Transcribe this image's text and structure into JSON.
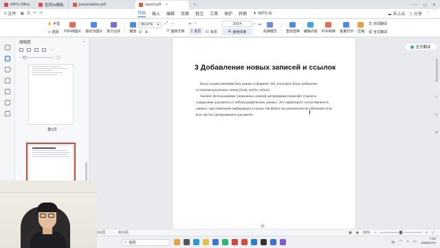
{
  "tabs": [
    {
      "label": "WPS Office",
      "color": "#d94a3c",
      "active": false
    },
    {
      "label": "稻壳AI模板",
      "color": "#e24a4a",
      "active": false
    },
    {
      "label": "presentation.pdf",
      "color": "#e05a3a",
      "active": false
    },
    {
      "label": "report.pdf",
      "color": "#e05a3a",
      "active": true
    }
  ],
  "menu": {
    "file": "文件",
    "items": [
      "开始",
      "插入",
      "编辑",
      "页面",
      "批注",
      "工具",
      "保护",
      "转换"
    ],
    "active": "开始",
    "wps_ai": "WPS AI",
    "right": [
      "未上云",
      "分享"
    ]
  },
  "ribbon": {
    "hand": "手型",
    "select": "选择",
    "pdf_to_pic": "PDF转图片",
    "export_pic": "输出为图片",
    "split_merge": "拆分合并",
    "play": "播放",
    "zoom": "80.47%",
    "rotate": "旋转文档",
    "single": "单页",
    "double": "双页",
    "page": "10/14",
    "continuous": "连续阅读",
    "read_mode": "阅读模式",
    "find": "查找替换",
    "edit_content": "编辑内容",
    "pdf_convert": "PDF转换",
    "batch_print": "批量打印",
    "compress": "压缩",
    "translate": "划词翻译",
    "full_translate": "全文翻译"
  },
  "sidebar": {
    "title": "缩略图",
    "page_label": "第9页",
    "page10_heading": "3 Добавление новых записей и ссылок"
  },
  "document": {
    "heading": "3  Добавление новых записей и ссылок",
    "paragraph1": "Была создана внешняя база данных в формате .bib, в которую были добавлены источники различных типов (book, article, online).",
    "paragraph2": "Анализ: Использование уникальных ключей цитирования позволяет отделить содержание документа от библиографических данных. Это гарантирует согласованность данных: при изменении информации в одном .bib файле она автоматически обновляется во всех местах цитирования в документе.",
    "page_number": "10"
  },
  "status": {
    "page": "第10页",
    "total": "共14页",
    "zoom": "80%"
  },
  "taskbar": {
    "search_placeholder": "搜索",
    "ime": "中",
    "time": "7:03",
    "date": "2026/1/17"
  },
  "colors": {
    "accent": "#2b6cdf",
    "selection": "#c94a3b"
  }
}
